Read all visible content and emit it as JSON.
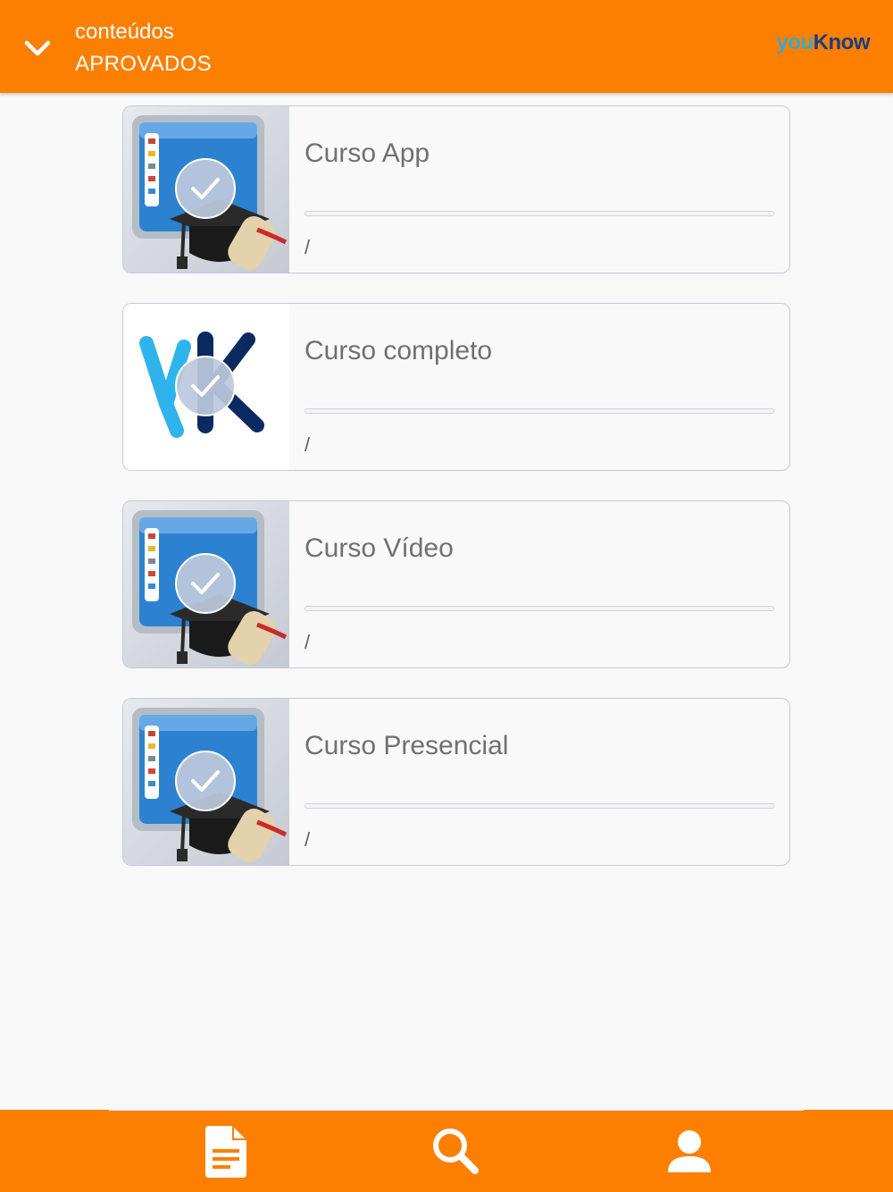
{
  "header": {
    "title_line1": "conteúdos",
    "title_line2": "APROVADOS",
    "back_icon": "chevron-down-icon",
    "logo_you": "you",
    "logo_know": "Know",
    "color": "#fd7f00"
  },
  "courses": [
    {
      "title": "Curso App",
      "progress": 0,
      "status": "/",
      "thumb": "course-default-thumbnail"
    },
    {
      "title": "Curso completo",
      "progress": 0,
      "status": "/",
      "thumb": "yk-logo-thumbnail"
    },
    {
      "title": "Curso Vídeo",
      "progress": 0,
      "status": "/",
      "thumb": "course-default-thumbnail"
    },
    {
      "title": "Curso Presencial",
      "progress": 0,
      "status": "/",
      "thumb": "course-default-thumbnail"
    }
  ],
  "bottom_nav": [
    {
      "name": "document-icon"
    },
    {
      "name": "search-icon"
    },
    {
      "name": "user-icon"
    }
  ]
}
